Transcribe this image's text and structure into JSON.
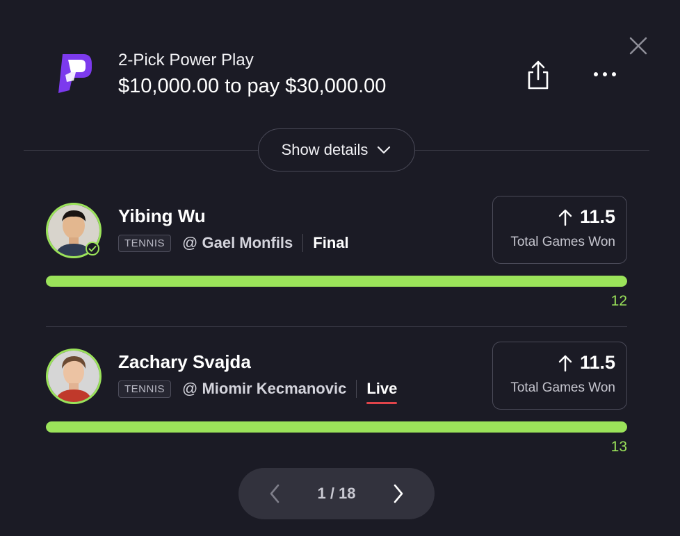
{
  "colors": {
    "accent": "#9be35a",
    "live": "#e0444a",
    "brand": "#7c3aed",
    "background": "#1b1b25"
  },
  "header": {
    "subtitle": "2-Pick Power Play",
    "headline": "$10,000.00 to pay $30,000.00"
  },
  "show_details_label": "Show details",
  "picks": [
    {
      "player": "Yibing Wu",
      "sport": "TENNIS",
      "at": "@",
      "opponent": "Gael Monfils",
      "status": "Final",
      "line": "11.5",
      "stat": "Total Games Won",
      "actual": "12",
      "progress": 1.0
    },
    {
      "player": "Zachary Svajda",
      "sport": "TENNIS",
      "at": "@",
      "opponent": "Miomir Kecmanovic",
      "status": "Live",
      "line": "11.5",
      "stat": "Total Games Won",
      "actual": "13",
      "progress": 1.0
    }
  ],
  "pager": {
    "text": "1 / 18"
  }
}
